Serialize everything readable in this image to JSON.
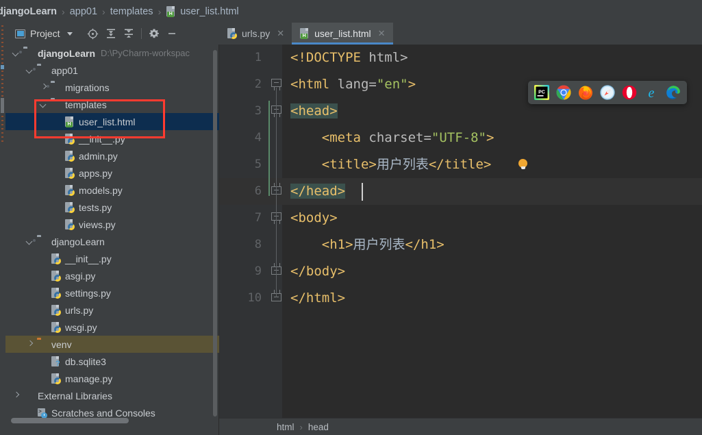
{
  "breadcrumb": {
    "items": [
      "djangoLearn",
      "app01",
      "templates",
      "user_list.html"
    ],
    "separator": "›"
  },
  "project_panel": {
    "title": "Project",
    "title_icon": "project-window-icon",
    "tools": [
      {
        "name": "locate-icon",
        "label": "Select Opened File"
      },
      {
        "name": "expand-all-icon",
        "label": "Expand All"
      },
      {
        "name": "collapse-all-icon",
        "label": "Collapse All"
      },
      {
        "name": "gear-icon",
        "label": "Settings"
      },
      {
        "name": "minimize-icon",
        "label": "Hide"
      }
    ],
    "tree": [
      {
        "label": "djangoLearn",
        "path": "D:\\PyCharm-workspac",
        "icon": "folder-module-icon",
        "indent": 0,
        "arrow": "open",
        "bold": true
      },
      {
        "label": "app01",
        "path": "",
        "icon": "folder-module-icon",
        "indent": 1,
        "arrow": "open",
        "bold": false
      },
      {
        "label": "migrations",
        "path": "",
        "icon": "folder-module-icon",
        "indent": 2,
        "arrow": "closed",
        "bold": false
      },
      {
        "label": "templates",
        "path": "",
        "icon": "folder-icon",
        "indent": 2,
        "arrow": "open",
        "bold": false
      },
      {
        "label": "user_list.html",
        "path": "",
        "icon": "html-file-icon",
        "indent": 3,
        "arrow": "none",
        "bold": false,
        "selected": true
      },
      {
        "label": "__init__.py",
        "path": "",
        "icon": "python-file-icon",
        "indent": 3,
        "arrow": "none",
        "bold": false
      },
      {
        "label": "admin.py",
        "path": "",
        "icon": "python-file-icon",
        "indent": 3,
        "arrow": "none",
        "bold": false
      },
      {
        "label": "apps.py",
        "path": "",
        "icon": "python-file-icon",
        "indent": 3,
        "arrow": "none",
        "bold": false
      },
      {
        "label": "models.py",
        "path": "",
        "icon": "python-file-icon",
        "indent": 3,
        "arrow": "none",
        "bold": false
      },
      {
        "label": "tests.py",
        "path": "",
        "icon": "python-file-icon",
        "indent": 3,
        "arrow": "none",
        "bold": false
      },
      {
        "label": "views.py",
        "path": "",
        "icon": "python-file-icon",
        "indent": 3,
        "arrow": "none",
        "bold": false
      },
      {
        "label": "djangoLearn",
        "path": "",
        "icon": "folder-module-icon",
        "indent": 1,
        "arrow": "open",
        "bold": false
      },
      {
        "label": "__init__.py",
        "path": "",
        "icon": "python-file-icon",
        "indent": 2,
        "arrow": "none",
        "bold": false
      },
      {
        "label": "asgi.py",
        "path": "",
        "icon": "python-file-icon",
        "indent": 2,
        "arrow": "none",
        "bold": false
      },
      {
        "label": "settings.py",
        "path": "",
        "icon": "python-file-icon",
        "indent": 2,
        "arrow": "none",
        "bold": false
      },
      {
        "label": "urls.py",
        "path": "",
        "icon": "python-file-icon",
        "indent": 2,
        "arrow": "none",
        "bold": false
      },
      {
        "label": "wsgi.py",
        "path": "",
        "icon": "python-file-icon",
        "indent": 2,
        "arrow": "none",
        "bold": false
      },
      {
        "label": "venv",
        "path": "",
        "icon": "folder-orange-icon",
        "indent": 1,
        "arrow": "closed",
        "bold": false,
        "highlight": true
      },
      {
        "label": "db.sqlite3",
        "path": "",
        "icon": "db-file-icon",
        "indent": 2,
        "arrow": "none",
        "bold": false
      },
      {
        "label": "manage.py",
        "path": "",
        "icon": "python-file-icon",
        "indent": 2,
        "arrow": "none",
        "bold": false
      },
      {
        "label": "External Libraries",
        "path": "",
        "icon": "libraries-icon",
        "indent": 0,
        "arrow": "closed",
        "bold": false
      },
      {
        "label": "Scratches and Consoles",
        "path": "",
        "icon": "scratches-icon",
        "indent": 1,
        "arrow": "none",
        "bold": false
      }
    ]
  },
  "editor": {
    "tabs": [
      {
        "label": "urls.py",
        "icon": "python-file-icon",
        "active": false,
        "close": "✕"
      },
      {
        "label": "user_list.html",
        "icon": "html-file-icon",
        "active": true,
        "close": "✕"
      }
    ],
    "lines": [
      {
        "num": "1",
        "segments": [
          {
            "t": "<!DOCTYPE ",
            "c": "tag"
          },
          {
            "t": "html>",
            "c": "attr"
          }
        ]
      },
      {
        "num": "2",
        "segments": [
          {
            "t": "<html ",
            "c": "tag"
          },
          {
            "t": "lang=",
            "c": "attr"
          },
          {
            "t": "\"en\"",
            "c": "val"
          },
          {
            "t": ">",
            "c": "tag"
          }
        ]
      },
      {
        "num": "3",
        "segments": [
          {
            "t": "<head>",
            "c": "tag",
            "hl": true
          }
        ]
      },
      {
        "num": "4",
        "segments": [
          {
            "t": "    <meta ",
            "c": "tag"
          },
          {
            "t": "charset=",
            "c": "attr"
          },
          {
            "t": "\"UTF-8\"",
            "c": "val"
          },
          {
            "t": ">",
            "c": "tag"
          }
        ]
      },
      {
        "num": "5",
        "segments": [
          {
            "t": "    <title>",
            "c": "tag"
          },
          {
            "t": "用户列表",
            "c": "txt"
          },
          {
            "t": "</title>",
            "c": "tag"
          }
        ]
      },
      {
        "num": "6",
        "segments": [
          {
            "t": "</head>",
            "c": "tag",
            "hl": true
          }
        ]
      },
      {
        "num": "7",
        "segments": [
          {
            "t": "<body>",
            "c": "tag"
          }
        ]
      },
      {
        "num": "8",
        "segments": [
          {
            "t": "    <h1>",
            "c": "tag"
          },
          {
            "t": "用户列表",
            "c": "txt"
          },
          {
            "t": "</h1>",
            "c": "tag"
          }
        ]
      },
      {
        "num": "9",
        "segments": [
          {
            "t": "</body>",
            "c": "tag"
          }
        ]
      },
      {
        "num": "10",
        "segments": [
          {
            "t": "</html>",
            "c": "tag"
          }
        ]
      }
    ],
    "current_line": 6,
    "intention_bulb_line": 5,
    "status_breadcrumb": [
      "html",
      "head"
    ],
    "status_separator": "›"
  },
  "browser_popup": {
    "items": [
      {
        "name": "pycharm-icon",
        "label": "PyCharm Built-in Preview"
      },
      {
        "name": "chrome-icon",
        "label": "Chrome"
      },
      {
        "name": "firefox-icon",
        "label": "Firefox"
      },
      {
        "name": "safari-icon",
        "label": "Safari"
      },
      {
        "name": "opera-icon",
        "label": "Opera"
      },
      {
        "name": "internet-explorer-icon",
        "label": "Internet Explorer"
      },
      {
        "name": "edge-icon",
        "label": "Edge"
      }
    ]
  },
  "colors": {
    "panel_bg": "#3c3f41",
    "editor_bg": "#2b2b2b",
    "selection": "#0d2d4f",
    "annotation_red": "#ff3b30",
    "tab_accent": "#4a88c7",
    "tag": "#e8bf6a",
    "attr_value": "#a5c261",
    "highlight_venv": "#5a5335"
  }
}
